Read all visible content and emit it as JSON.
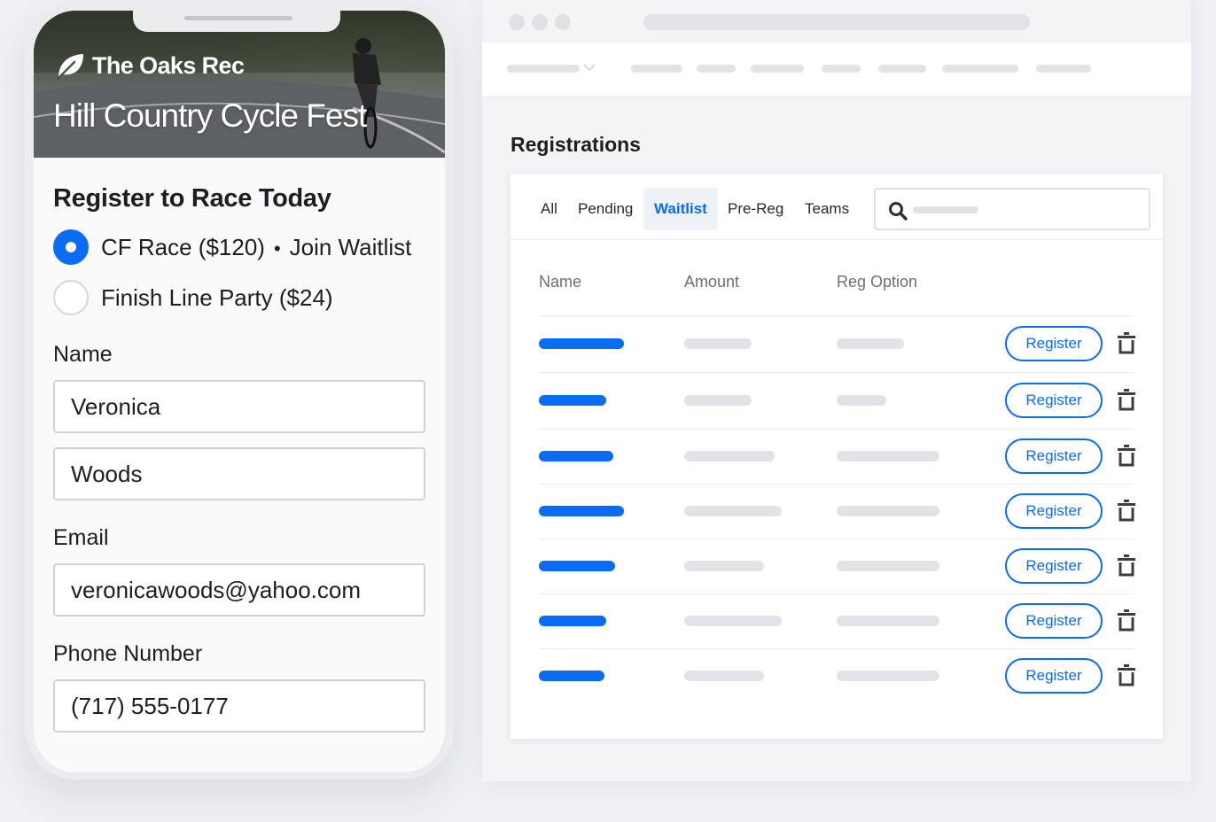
{
  "phone": {
    "brand": "The Oaks Rec",
    "event_title": "Hill Country Cycle Fest",
    "form_title": "Register to Race Today",
    "options": [
      {
        "label": "CF Race ($120)",
        "extra": "Join Waitlist",
        "selected": true
      },
      {
        "label": "Finish Line Party ($24)",
        "extra": "",
        "selected": false
      }
    ],
    "name_label": "Name",
    "first_name": "Veronica",
    "last_name": "Woods",
    "email_label": "Email",
    "email": "veronicawoods@yahoo.com",
    "phone_label": "Phone Number",
    "phone": "(717) 555-0177"
  },
  "browser": {
    "page_title": "Registrations",
    "tabs": [
      "All",
      "Pending",
      "Waitlist",
      "Pre-Reg",
      "Teams"
    ],
    "active_tab": "Waitlist",
    "columns": [
      "Name",
      "Amount",
      "Reg Option"
    ],
    "rows": [
      {
        "action": "Register"
      },
      {
        "action": "Register"
      },
      {
        "action": "Register"
      },
      {
        "action": "Register"
      },
      {
        "action": "Register"
      },
      {
        "action": "Register"
      },
      {
        "action": "Register"
      }
    ]
  },
  "icons": {
    "brand": "leaf-icon",
    "search": "search-icon",
    "delete": "trash-icon",
    "nav_dropdown": "chevron-down-icon"
  },
  "colors": {
    "accent": "#0a6cf5",
    "placeholder": "#e1e3e7",
    "background": "#eef0f4"
  }
}
